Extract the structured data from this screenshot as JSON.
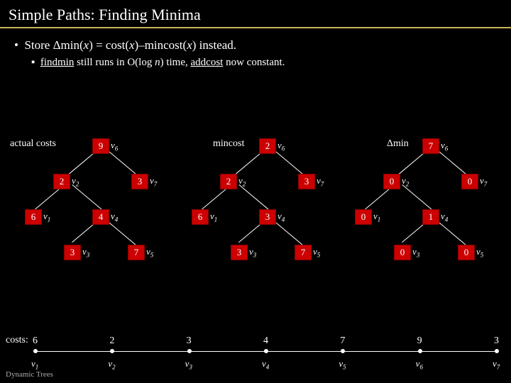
{
  "title": "Simple Paths: Finding Minima",
  "bullet1_pre": "Store ",
  "bullet1_dmin": "min(",
  "bullet1_x1": "x",
  "bullet1_eq": ") = cost(",
  "bullet1_x2": "x",
  "bullet1_mid": ")–mincost(",
  "bullet1_x3": "x",
  "bullet1_end": ") instead.",
  "bullet2_pre": "",
  "bullet2_findmin": "findmin",
  "bullet2_mid": " still runs in O(log ",
  "bullet2_n": "n",
  "bullet2_mid2": ") time, ",
  "bullet2_addcost": "addcost",
  "bullet2_end": " now constant.",
  "hdr_actual": "actual costs",
  "hdr_mincost": "mincost",
  "hdr_dmin": "Δmin",
  "trees": {
    "actual": {
      "v6": "9",
      "v2": "2",
      "v7": "3",
      "v1": "6",
      "v4": "4",
      "v3": "3",
      "v5": "7"
    },
    "mincost": {
      "v6": "2",
      "v2": "2",
      "v7": "3",
      "v1": "6",
      "v4": "3",
      "v3": "3",
      "v5": "7"
    },
    "dmin": {
      "v6": "7",
      "v2": "0",
      "v7": "0",
      "v1": "0",
      "v4": "1",
      "v3": "0",
      "v5": "0"
    }
  },
  "vlabels": {
    "v1": "v",
    "v2": "v",
    "v3": "v",
    "v4": "v",
    "v5": "v",
    "v6": "v",
    "v7": "v"
  },
  "vsubs": {
    "v1": "1",
    "v2": "2",
    "v3": "3",
    "v4": "4",
    "v5": "5",
    "v6": "6",
    "v7": "7"
  },
  "chain": {
    "costs_label": "costs:",
    "values": [
      "6",
      "2",
      "3",
      "4",
      "7",
      "9",
      "3"
    ],
    "labels": [
      "v",
      "v",
      "v",
      "v",
      "v",
      "v",
      "v"
    ],
    "subs": [
      "1",
      "2",
      "3",
      "4",
      "5",
      "6",
      "7"
    ]
  },
  "footer": "Dynamic Trees"
}
